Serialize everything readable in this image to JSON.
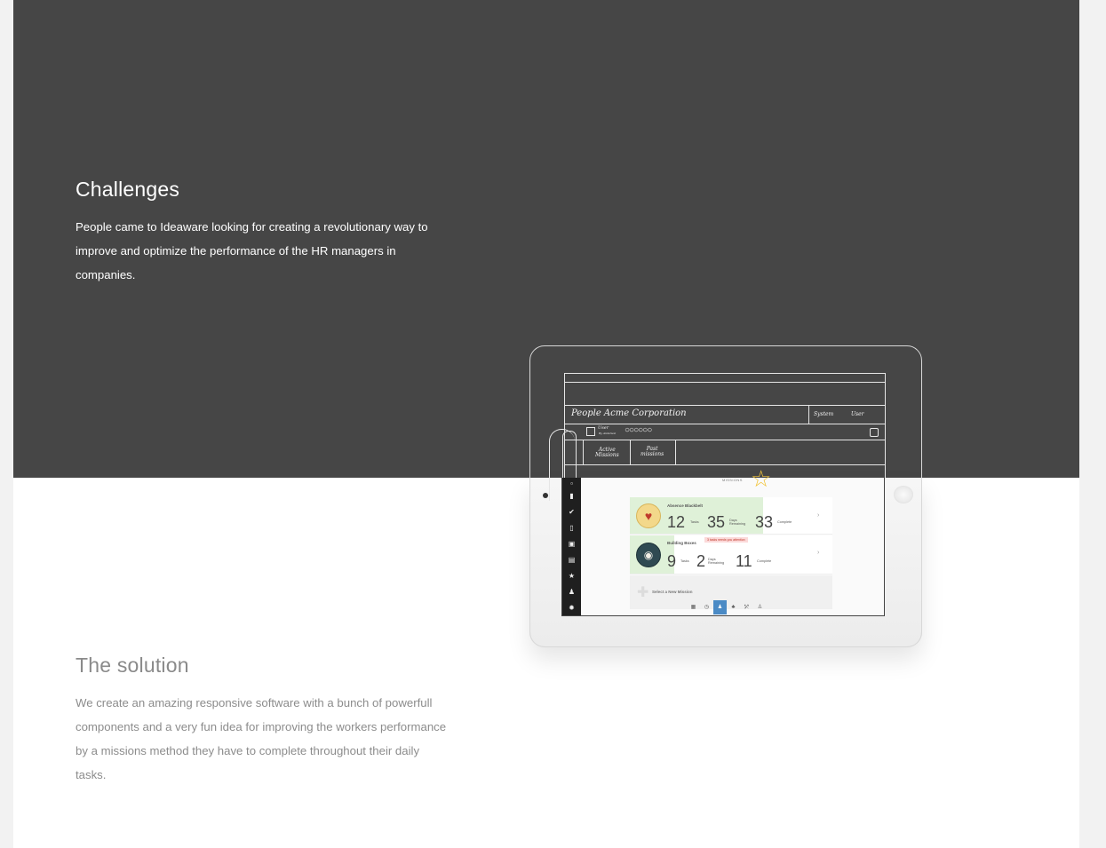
{
  "challenges": {
    "title": "Challenges",
    "text": "People came to Ideaware looking for creating a revolutionary way to improve and optimize the performance of the HR managers in companies."
  },
  "solution": {
    "title": "The solution",
    "text": "We create an amazing responsive software with a bunch of powerfull components and a very fun idea for improving the workers performance by a missions method they have to complete throughout their daily tasks."
  },
  "colors": {
    "dark_band": "#464646",
    "page": "#ffffff",
    "outer": "#f2f2f2",
    "mission_fill": "#dff1d8",
    "active_tab": "#4a8ac5"
  },
  "mockup": {
    "wireframe": {
      "company": "People Acme Corporation",
      "system": "System",
      "user": "User",
      "user_row_label": "User",
      "user_row_sub": "By Anderson",
      "tab_active_line1": "Active",
      "tab_active_line2": "Missions",
      "tab_past_line1": "Past",
      "tab_past_line2": "missions"
    },
    "screen": {
      "section_label": "MISSIONS",
      "missions": [
        {
          "name": "Absence Blackbelt",
          "tasks": "12",
          "tasks_label": "Tasks",
          "days": "35",
          "days_label_1": "Days",
          "days_label_2": "Remaining",
          "percent": "33",
          "percent_label": "Complete",
          "progress": 0.33,
          "icon": "heart-icon"
        },
        {
          "name": "Building Boxes",
          "alert": "3 tasks needs you attention",
          "tasks": "9",
          "tasks_label": "Tasks",
          "days": "2",
          "days_label_1": "Days",
          "days_label_2": "Remaining",
          "percent": "11",
          "percent_label": "Complete",
          "progress": 0.11,
          "icon": "palette-icon"
        }
      ],
      "add_mission": "Select a New Mission"
    }
  }
}
